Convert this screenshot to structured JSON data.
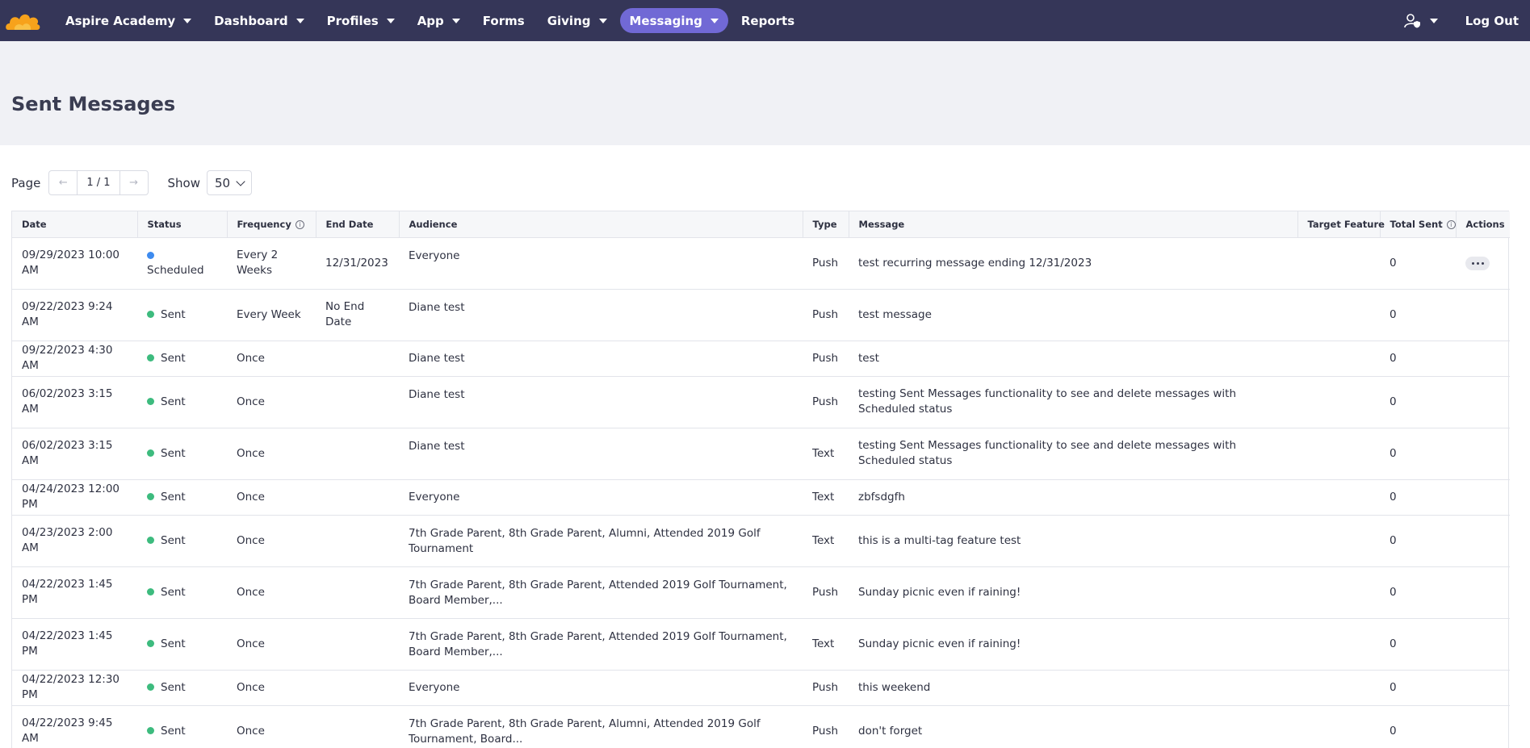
{
  "nav": {
    "brand": "Aspire Academy",
    "items": [
      {
        "label": "Dashboard",
        "dropdown": true,
        "active": false
      },
      {
        "label": "Profiles",
        "dropdown": true,
        "active": false
      },
      {
        "label": "App",
        "dropdown": true,
        "active": false
      },
      {
        "label": "Forms",
        "dropdown": false,
        "active": false
      },
      {
        "label": "Giving",
        "dropdown": true,
        "active": false
      },
      {
        "label": "Messaging",
        "dropdown": true,
        "active": true
      },
      {
        "label": "Reports",
        "dropdown": false,
        "active": false
      }
    ],
    "logout": "Log Out",
    "colors": {
      "bar": "#353658",
      "active": "#7169d5",
      "logo": "#f7a21b"
    }
  },
  "page": {
    "title": "Sent Messages"
  },
  "controls": {
    "page_label": "Page",
    "page_value": "1 / 1",
    "show_label": "Show",
    "show_value": "50"
  },
  "table": {
    "columns": [
      "Date",
      "Status",
      "Frequency",
      "End Date",
      "Audience",
      "Type",
      "Message",
      "Target Feature",
      "Total Sent",
      "Actions"
    ],
    "rows": [
      {
        "date": "09/29/2023 10:00 AM",
        "status": "Scheduled",
        "frequency": "Every 2 Weeks",
        "end_date": "12/31/2023",
        "audience": "Everyone",
        "type": "Push",
        "message": "test recurring message ending 12/31/2023",
        "target": "",
        "total": "0",
        "actions": true
      },
      {
        "date": "09/22/2023 9:24 AM",
        "status": "Sent",
        "frequency": "Every Week",
        "end_date": "No End Date",
        "audience": "Diane test",
        "type": "Push",
        "message": "test message",
        "target": "",
        "total": "0",
        "actions": false
      },
      {
        "date": "09/22/2023 4:30 AM",
        "status": "Sent",
        "frequency": "Once",
        "end_date": "",
        "audience": "Diane test",
        "type": "Push",
        "message": "test",
        "target": "",
        "total": "0",
        "actions": false
      },
      {
        "date": "06/02/2023 3:15 AM",
        "status": "Sent",
        "frequency": "Once",
        "end_date": "",
        "audience": "Diane test",
        "type": "Push",
        "message": "testing Sent Messages functionality to see and delete messages with Scheduled status",
        "target": "",
        "total": "0",
        "actions": false
      },
      {
        "date": "06/02/2023 3:15 AM",
        "status": "Sent",
        "frequency": "Once",
        "end_date": "",
        "audience": "Diane test",
        "type": "Text",
        "message": "testing Sent Messages functionality to see and delete messages with Scheduled status",
        "target": "",
        "total": "0",
        "actions": false
      },
      {
        "date": "04/24/2023 12:00 PM",
        "status": "Sent",
        "frequency": "Once",
        "end_date": "",
        "audience": "Everyone",
        "type": "Text",
        "message": "zbfsdgfh",
        "target": "",
        "total": "0",
        "actions": false
      },
      {
        "date": "04/23/2023 2:00 AM",
        "status": "Sent",
        "frequency": "Once",
        "end_date": "",
        "audience": "7th Grade Parent, 8th Grade Parent, Alumni, Attended 2019 Golf Tournament",
        "type": "Text",
        "message": "this is a multi-tag feature test",
        "target": "",
        "total": "0",
        "actions": false
      },
      {
        "date": "04/22/2023 1:45 PM",
        "status": "Sent",
        "frequency": "Once",
        "end_date": "",
        "audience": "7th Grade Parent, 8th Grade Parent, Attended 2019 Golf Tournament, Board Member,...",
        "type": "Push",
        "message": "Sunday picnic even if raining!",
        "target": "",
        "total": "0",
        "actions": false
      },
      {
        "date": "04/22/2023 1:45 PM",
        "status": "Sent",
        "frequency": "Once",
        "end_date": "",
        "audience": "7th Grade Parent, 8th Grade Parent, Attended 2019 Golf Tournament, Board Member,...",
        "type": "Text",
        "message": "Sunday picnic even if raining!",
        "target": "",
        "total": "0",
        "actions": false
      },
      {
        "date": "04/22/2023 12:30 PM",
        "status": "Sent",
        "frequency": "Once",
        "end_date": "",
        "audience": "Everyone",
        "type": "Push",
        "message": "this weekend",
        "target": "",
        "total": "0",
        "actions": false
      },
      {
        "date": "04/22/2023 9:45 AM",
        "status": "Sent",
        "frequency": "Once",
        "end_date": "",
        "audience": "7th Grade Parent, 8th Grade Parent, Alumni, Attended 2019 Golf Tournament, Board...",
        "type": "Push",
        "message": "don't forget",
        "target": "",
        "total": "0",
        "actions": false
      }
    ]
  },
  "colors": {
    "sent": "#3dbb7e",
    "scheduled": "#3d8bef"
  }
}
